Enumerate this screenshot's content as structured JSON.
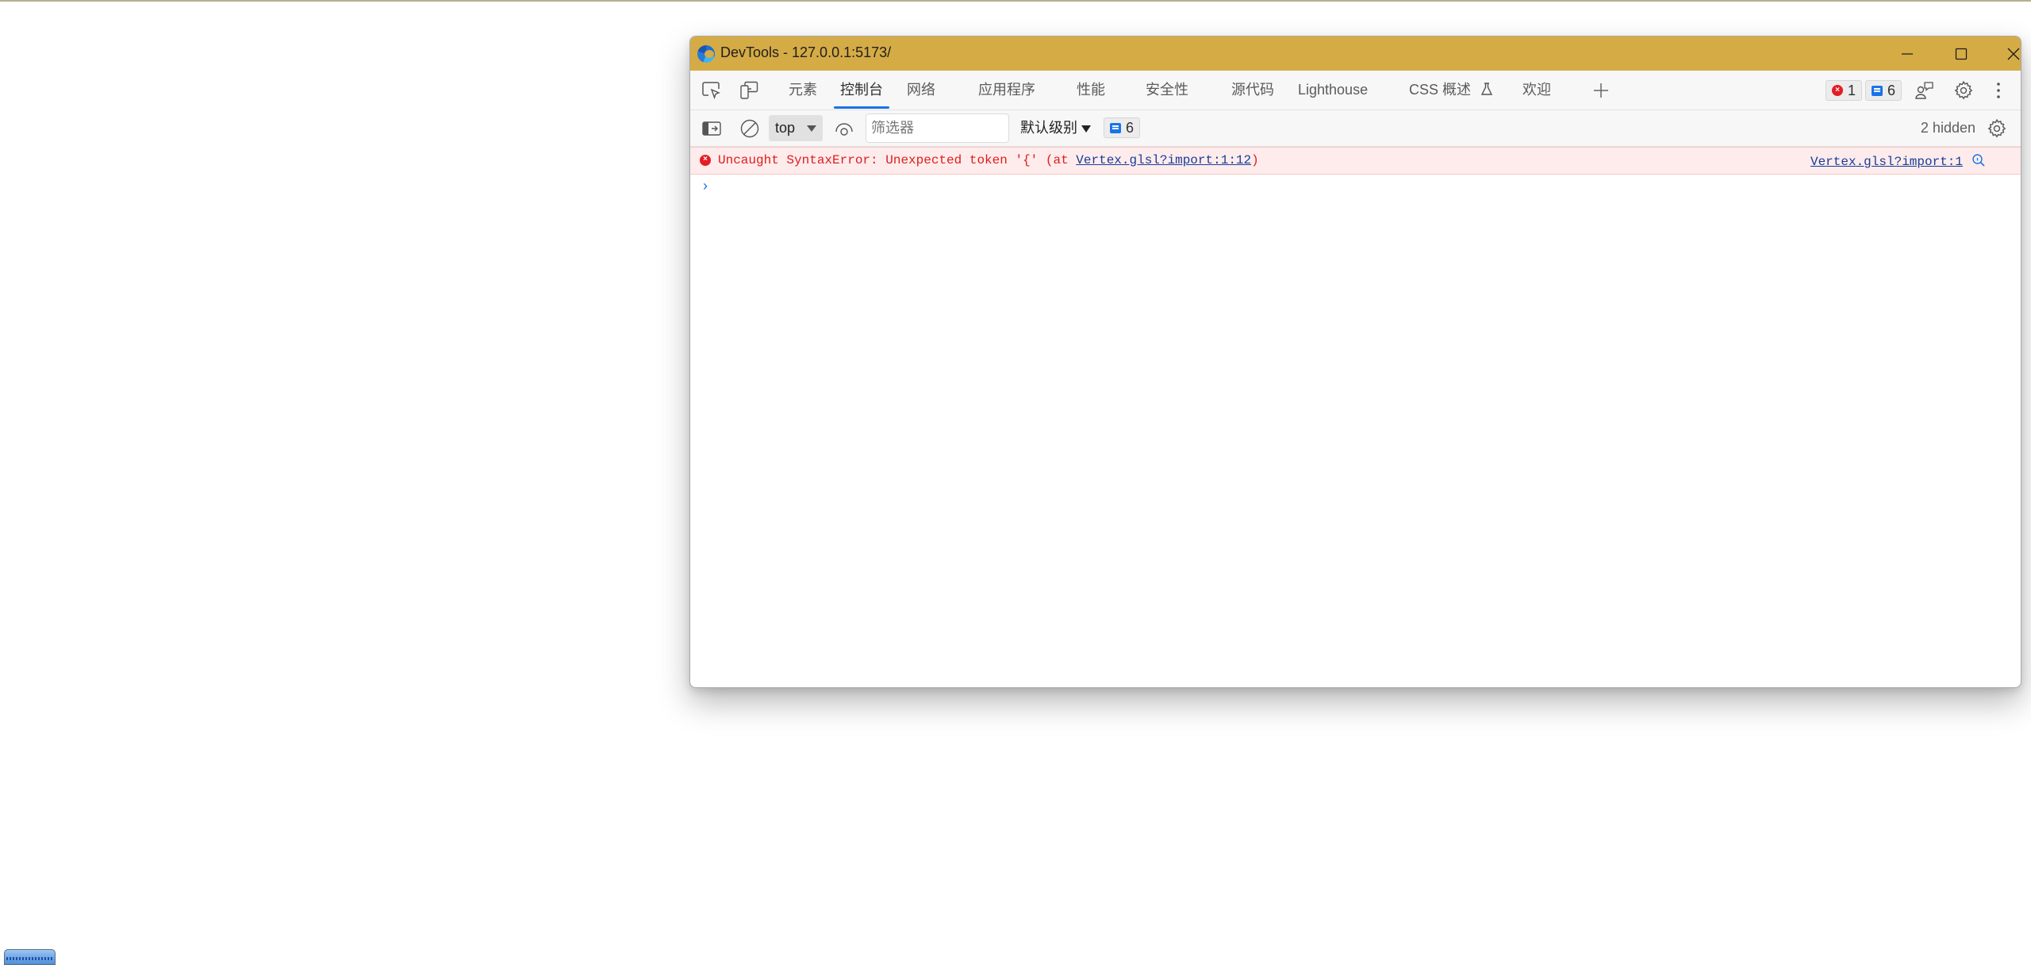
{
  "window": {
    "title": "DevTools - 127.0.0.1:5173/",
    "controls": {
      "minimize": "minimize-icon",
      "maximize": "maximize-icon",
      "close": "close-icon"
    }
  },
  "tabbar": {
    "left_icons": [
      "inspect-element-icon",
      "device-toolbar-icon"
    ],
    "tabs": [
      {
        "label": "元素",
        "active": false
      },
      {
        "label": "控制台",
        "active": true
      },
      {
        "label": "网络",
        "active": false
      },
      {
        "label": "应用程序",
        "active": false
      },
      {
        "label": "性能",
        "active": false
      },
      {
        "label": "安全性",
        "active": false
      },
      {
        "label": "源代码",
        "active": false
      },
      {
        "label": "Lighthouse",
        "active": false
      },
      {
        "label": "CSS 概述",
        "active": false,
        "icon": "flask-icon"
      },
      {
        "label": "欢迎",
        "active": false
      }
    ],
    "add_tab": "+",
    "error_count": "1",
    "message_count": "6",
    "right_icons": [
      "feedback-icon",
      "settings-icon",
      "more-options-icon"
    ]
  },
  "console_toolbar": {
    "context": "top",
    "filter_placeholder": "筛选器",
    "filter_value": "",
    "level": "默认级别",
    "message_count": "6",
    "hidden": "2 hidden"
  },
  "console": {
    "messages": [
      {
        "type": "error",
        "text_before": "Uncaught SyntaxError: Unexpected token '{' (at ",
        "link": "Vertex.glsl?import:1:12",
        "text_after": ")",
        "source": "Vertex.glsl?import:1"
      }
    ],
    "prompt": "›"
  },
  "colors": {
    "titlebar": "#d5ab45",
    "accent": "#1a73e8",
    "error": "#e01b1b",
    "error_bg": "#fdeceb"
  }
}
